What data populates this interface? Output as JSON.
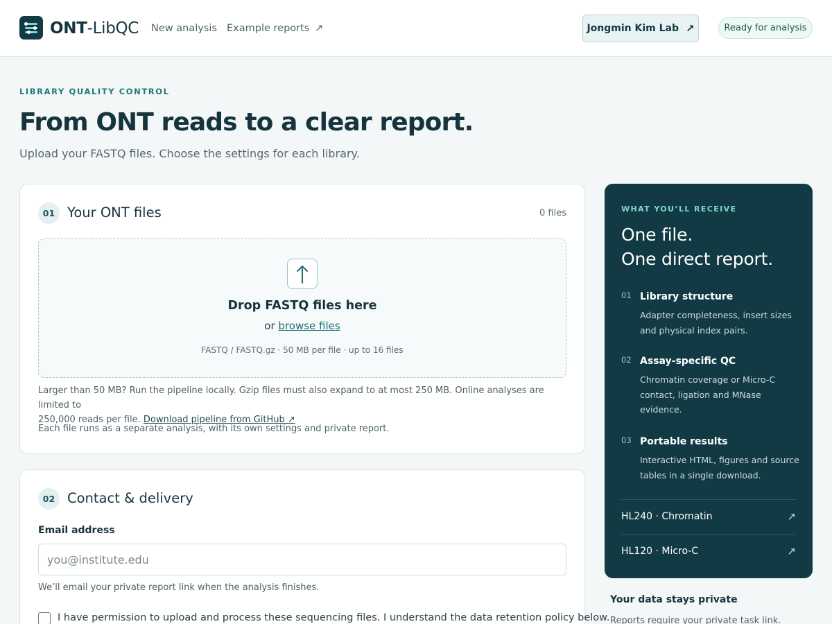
{
  "header": {
    "brand_bold": "ONT",
    "brand_rest": "-LibQC",
    "nav": {
      "new_analysis": "New analysis",
      "example_reports": "Example reports",
      "example_arrow": "↗"
    },
    "lab_button": {
      "label": "Jongmin Kim Lab",
      "arrow": "↗"
    },
    "status": "Ready for analysis"
  },
  "hero": {
    "eyebrow": "LIBRARY QUALITY CONTROL",
    "title": "From ONT reads to a clear report.",
    "subtitle": "Upload your FASTQ files. Choose the settings for each library."
  },
  "files_card": {
    "step": "01",
    "title": "Your ONT files",
    "count": "0 files",
    "dropzone": {
      "title": "Drop FASTQ files here",
      "or_text": "or",
      "browse_link": "browse files",
      "meta": "FASTQ / FASTQ.gz · 50 MB per file · up to 16 files"
    },
    "limit_note_line1": "Larger than 50 MB? Run the pipeline locally. Gzip files must also expand to at most 250 MB. Online analyses are limited to",
    "limit_note_line2": "250,000 reads per file.",
    "github_link": "Download pipeline from GitHub ↗",
    "separate_note": "Each file runs as a separate analysis, with its own settings and private report."
  },
  "contact_card": {
    "step": "02",
    "title": "Contact & delivery",
    "email_label": "Email address",
    "email_placeholder": "you@institute.edu",
    "email_value": "",
    "email_help": "We’ll email your private report link when the analysis finishes.",
    "consent_checked": false,
    "consent_text": "I have permission to upload and process these sequencing files. I understand the data retention policy below."
  },
  "panel": {
    "eyebrow": "WHAT YOU’LL RECEIVE",
    "heading_line1": "One file.",
    "heading_line2": "One direct report.",
    "features": [
      {
        "num": "01",
        "title": "Library structure",
        "desc": "Adapter completeness, insert sizes and physical index pairs."
      },
      {
        "num": "02",
        "title": "Assay-specific QC",
        "desc": "Chromatin coverage or Micro-C contact, ligation and MNase evidence."
      },
      {
        "num": "03",
        "title": "Portable results",
        "desc": "Interactive HTML, figures and source tables in a single download."
      }
    ],
    "examples": [
      {
        "label": "HL240 · Chromatin",
        "arrow": "↗"
      },
      {
        "label": "HL120 · Micro-C",
        "arrow": "↗"
      }
    ]
  },
  "privacy": {
    "title": "Your data stays private",
    "text": "Reports require your private task link."
  },
  "colors": {
    "accent": "#1f7a78",
    "panel_bg": "#123a44",
    "panel_accent": "#7fd6c8",
    "page_bg": "#f4f7f8"
  },
  "icons": {
    "logo": "sliders-logo-icon",
    "upload": "arrow-up-icon",
    "external": "arrow-up-right-icon"
  }
}
